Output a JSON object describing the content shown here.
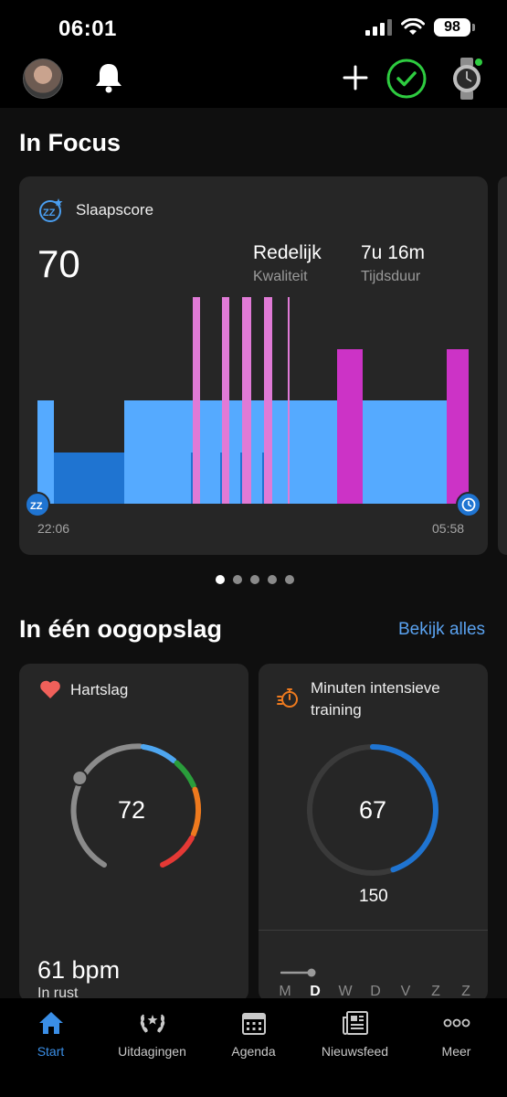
{
  "status": {
    "time": "06:01",
    "battery": "98"
  },
  "focus": {
    "title": "In Focus",
    "card": {
      "label": "Slaapscore",
      "score": "70",
      "quality_value": "Redelijk",
      "quality_label": "Kwaliteit",
      "duration_value": "7u 16m",
      "duration_label": "Tijdsduur",
      "start_time": "22:06",
      "end_time": "05:58"
    },
    "page_count": 5,
    "active_page": 1
  },
  "sleep_stage_colors": {
    "light": "#55aaff",
    "deep": "#1f74d1",
    "rem": "#e07ad6",
    "awake": "#cc33c6"
  },
  "glance": {
    "title": "In één oogopslag",
    "see_all": "Bekijk alles",
    "heart": {
      "label": "Hartslag",
      "value": "72",
      "resting": "61 bpm",
      "resting_label": "In rust"
    },
    "intensity": {
      "label": "Minuten intensieve training",
      "value": "67",
      "goal": "150",
      "progress": 0.447,
      "days": [
        "M",
        "D",
        "W",
        "D",
        "V",
        "Z",
        "Z"
      ],
      "active_day_index": 1
    }
  },
  "nav": {
    "items": [
      {
        "label": "Start",
        "icon": "home-icon"
      },
      {
        "label": "Uitdagingen",
        "icon": "laurel-icon"
      },
      {
        "label": "Agenda",
        "icon": "calendar-icon"
      },
      {
        "label": "Nieuwsfeed",
        "icon": "newsfeed-icon"
      },
      {
        "label": "Meer",
        "icon": "more-dots-icon"
      }
    ]
  }
}
